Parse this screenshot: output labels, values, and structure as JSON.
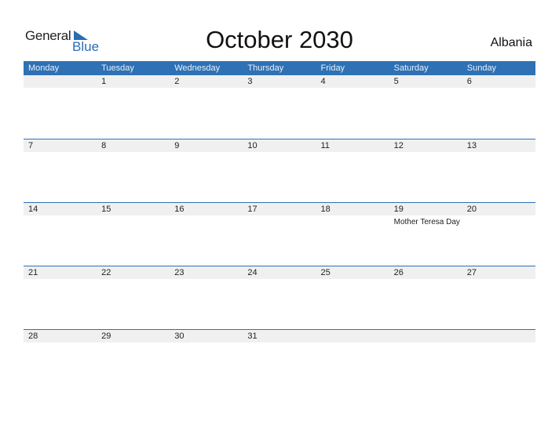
{
  "logo": {
    "line1": "General",
    "line2": "Blue"
  },
  "title": "October 2030",
  "country": "Albania",
  "weekdays": [
    "Monday",
    "Tuesday",
    "Wednesday",
    "Thursday",
    "Friday",
    "Saturday",
    "Sunday"
  ],
  "weeks": [
    {
      "days": [
        "",
        "1",
        "2",
        "3",
        "4",
        "5",
        "6"
      ],
      "events": [
        "",
        "",
        "",
        "",
        "",
        "",
        ""
      ]
    },
    {
      "days": [
        "7",
        "8",
        "9",
        "10",
        "11",
        "12",
        "13"
      ],
      "events": [
        "",
        "",
        "",
        "",
        "",
        "",
        ""
      ]
    },
    {
      "days": [
        "14",
        "15",
        "16",
        "17",
        "18",
        "19",
        "20"
      ],
      "events": [
        "",
        "",
        "",
        "",
        "",
        "Mother Teresa Day",
        ""
      ]
    },
    {
      "days": [
        "21",
        "22",
        "23",
        "24",
        "25",
        "26",
        "27"
      ],
      "events": [
        "",
        "",
        "",
        "",
        "",
        "",
        ""
      ]
    },
    {
      "days": [
        "28",
        "29",
        "30",
        "31",
        "",
        "",
        ""
      ],
      "events": [
        "",
        "",
        "",
        "",
        "",
        "",
        ""
      ]
    }
  ],
  "colors": {
    "accent": "#2e71b4",
    "strip": "#f0f0f0"
  }
}
